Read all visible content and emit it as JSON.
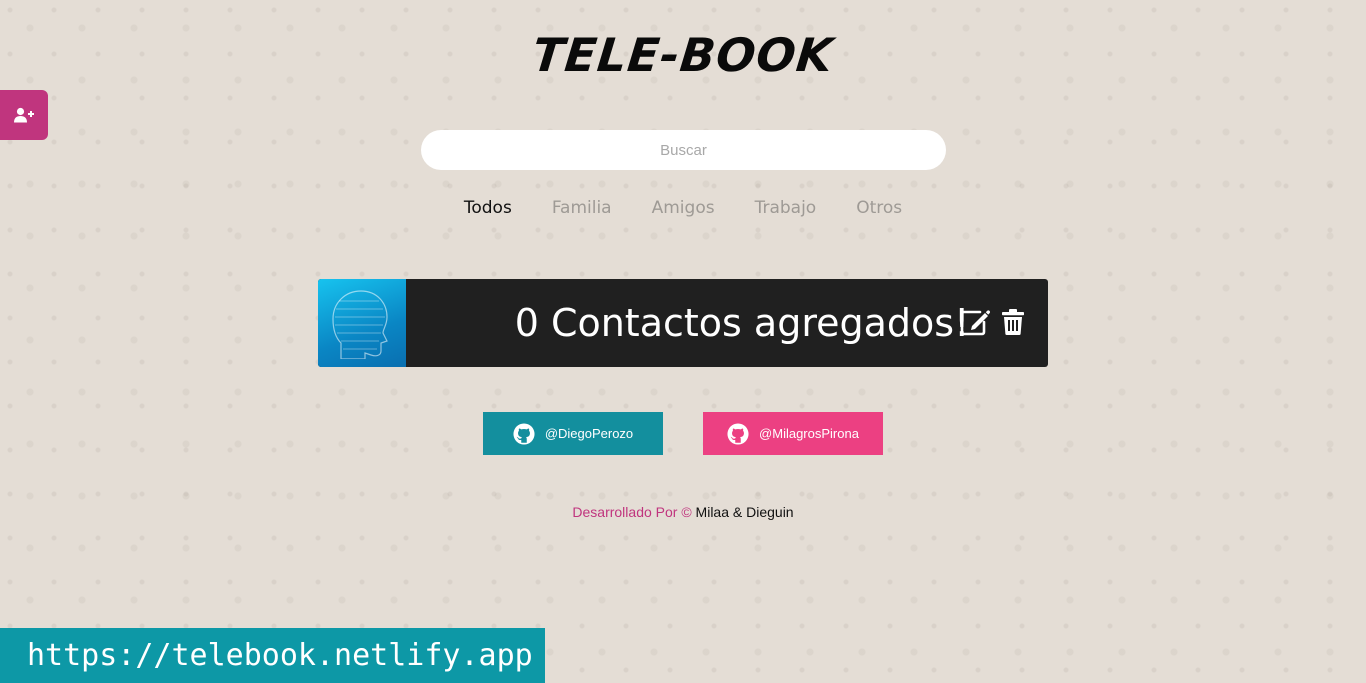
{
  "app": {
    "title": "TELE-BOOK"
  },
  "search": {
    "placeholder": "Buscar",
    "value": ""
  },
  "tabs": [
    {
      "label": "Todos",
      "active": true
    },
    {
      "label": "Familia",
      "active": false
    },
    {
      "label": "Amigos",
      "active": false
    },
    {
      "label": "Trabajo",
      "active": false
    },
    {
      "label": "Otros",
      "active": false
    }
  ],
  "sidebar": {
    "add_contact_icon": "user-plus-icon"
  },
  "card": {
    "text": "0 Contactos agregados!",
    "edit_icon": "edit-icon",
    "delete_icon": "trash-icon"
  },
  "links": [
    {
      "label": "@DiegoPerozo",
      "icon": "github-icon",
      "color": "#138f9e"
    },
    {
      "label": "@MilagrosPirona",
      "icon": "github-icon",
      "color": "#ec4082"
    }
  ],
  "footer": {
    "prefix": "Desarrollado Por ©",
    "names": "Milaa & Dieguin"
  },
  "url_banner": "https://telebook.netlify.app",
  "colors": {
    "accent_pink": "#c0357e",
    "teal": "#138f9e",
    "pink": "#ec4082",
    "card_bg": "#202020",
    "page_bg": "#e4ddd5"
  }
}
